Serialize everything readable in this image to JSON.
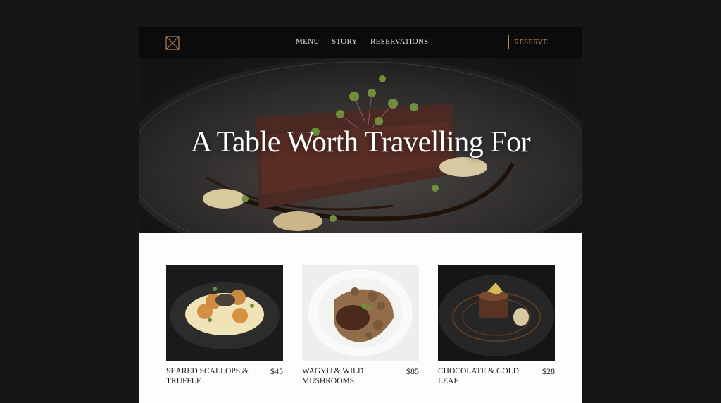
{
  "brand": {
    "logo_icon": "envelope-monogram-icon",
    "accent": "#b8845a"
  },
  "nav": {
    "items": [
      {
        "label": "MENU"
      },
      {
        "label": "STORY"
      },
      {
        "label": "RESERVATIONS"
      }
    ],
    "cta_label": "RESERVE"
  },
  "hero": {
    "title": "A Table Worth Travelling For"
  },
  "dishes": [
    {
      "name": "SEARED SCALLOPS & TRUFFLE",
      "price": "$45"
    },
    {
      "name": "WAGYU & WILD MUSHROOMS",
      "price": "$85"
    },
    {
      "name": "CHOCOLATE & GOLD LEAF",
      "price": "$28"
    }
  ]
}
